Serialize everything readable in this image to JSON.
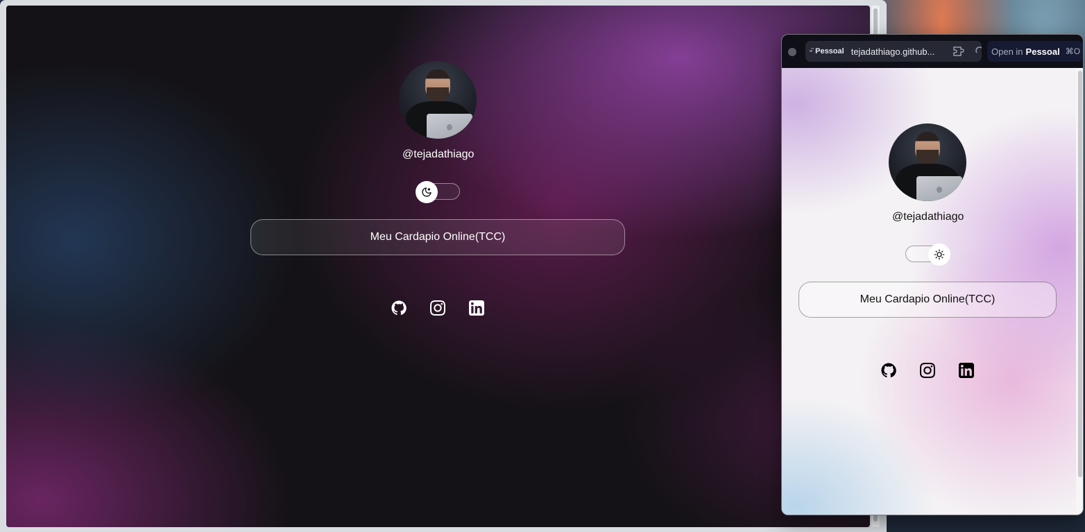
{
  "main": {
    "handle": "@tejadathiago",
    "theme_toggle_icon": "moon-icon",
    "link_button_label": "Meu Cardapio Online(TCC)",
    "social_icons": [
      "github-icon",
      "instagram-icon",
      "linkedin-icon"
    ]
  },
  "popup": {
    "profile_chip": "Pessoal",
    "url": "tejadathiago.github...",
    "open_in_prefix": "Open in",
    "open_in_profile": "Pessoal",
    "open_in_shortcut": "⌘O",
    "handle": "@tejadathiago",
    "theme_toggle_icon": "sun-icon",
    "link_button_label": "Meu Cardapio Online(TCC)",
    "social_icons": [
      "github-icon",
      "instagram-icon",
      "linkedin-icon"
    ]
  },
  "colors": {
    "dark_bg": "#141216",
    "light_bg": "#f4f2f4",
    "popup_toolbar": "#0e0f17"
  }
}
